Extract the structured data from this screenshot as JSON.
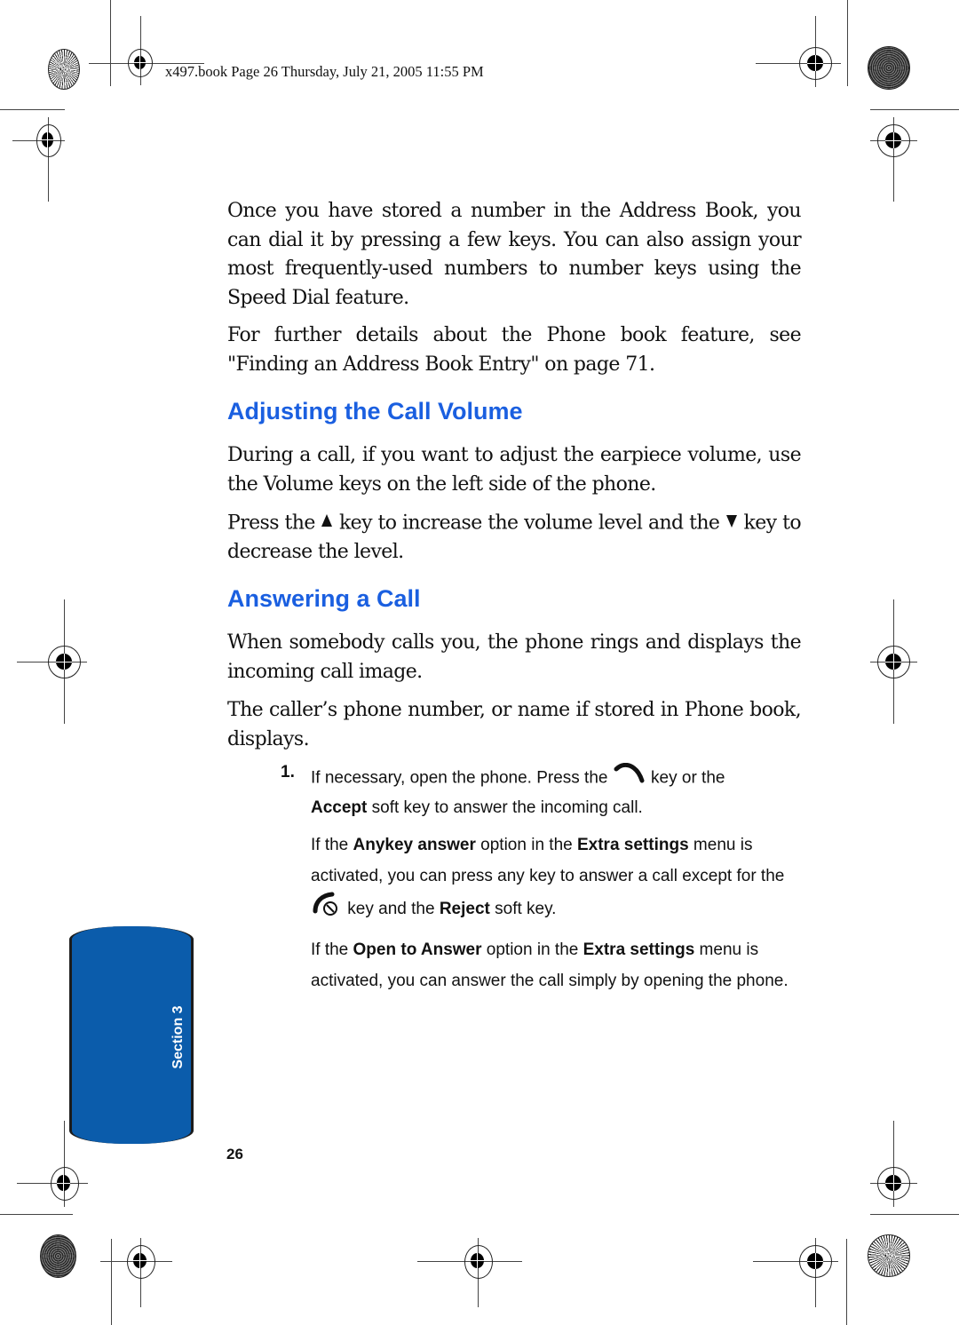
{
  "header": {
    "print_slug": "x497.book  Page 26  Thursday, July 21, 2005  11:55 PM"
  },
  "content": {
    "intro_paragraphs": [
      "Once you have stored a number in the Address Book, you can dial it by pressing a few keys. You can also assign your most frequently-used numbers to number keys using the Speed Dial feature.",
      "For further details about the Phone book feature, see \"Finding an Address Book Entry\" on page 71."
    ],
    "section_volume": {
      "heading": "Adjusting the Call Volume",
      "paragraph1": "During a call, if you want to adjust the earpiece volume, use the Volume keys on the left side of the phone.",
      "paragraph2": {
        "part1": "Press the",
        "part2": "key to increase the volume level and the",
        "part3": "key to decrease the level."
      }
    },
    "section_answering": {
      "heading": "Answering a Call",
      "paragraph1": "When somebody calls you, the phone rings and displays the incoming call image.",
      "paragraph2": "The caller’s phone number, or name if stored in Phone book, displays.",
      "step1": {
        "number": "1.",
        "line_a1": "If necessary, open the phone. Press the",
        "line_a2": "key or the",
        "bold_accept": "Accept",
        "line_a3": "soft key to answer the incoming call.",
        "note1": {
          "t1": "If the",
          "b1": "Anykey answer",
          "t2": "option in the",
          "b2": "Extra settings",
          "t3": "menu is activated, you can press any key to answer a call except for the",
          "t4": "key and the",
          "b3": "Reject",
          "t5": "soft key."
        },
        "note2": {
          "t1": "If the",
          "b1": "Open to Answer",
          "t2": "option in the",
          "b2": "Extra settings",
          "t3": "menu is activated, you can answer the call simply by opening the phone."
        }
      }
    }
  },
  "side_tab": {
    "label": "Section 3",
    "color": "#0b5cab"
  },
  "footer": {
    "page_number": "26"
  },
  "colors": {
    "heading": "#1a5fe0"
  },
  "icons": {
    "volume_up": "volume-up-key-icon",
    "volume_down": "volume-down-key-icon",
    "send": "send-key-icon",
    "end": "end-key-icon"
  }
}
